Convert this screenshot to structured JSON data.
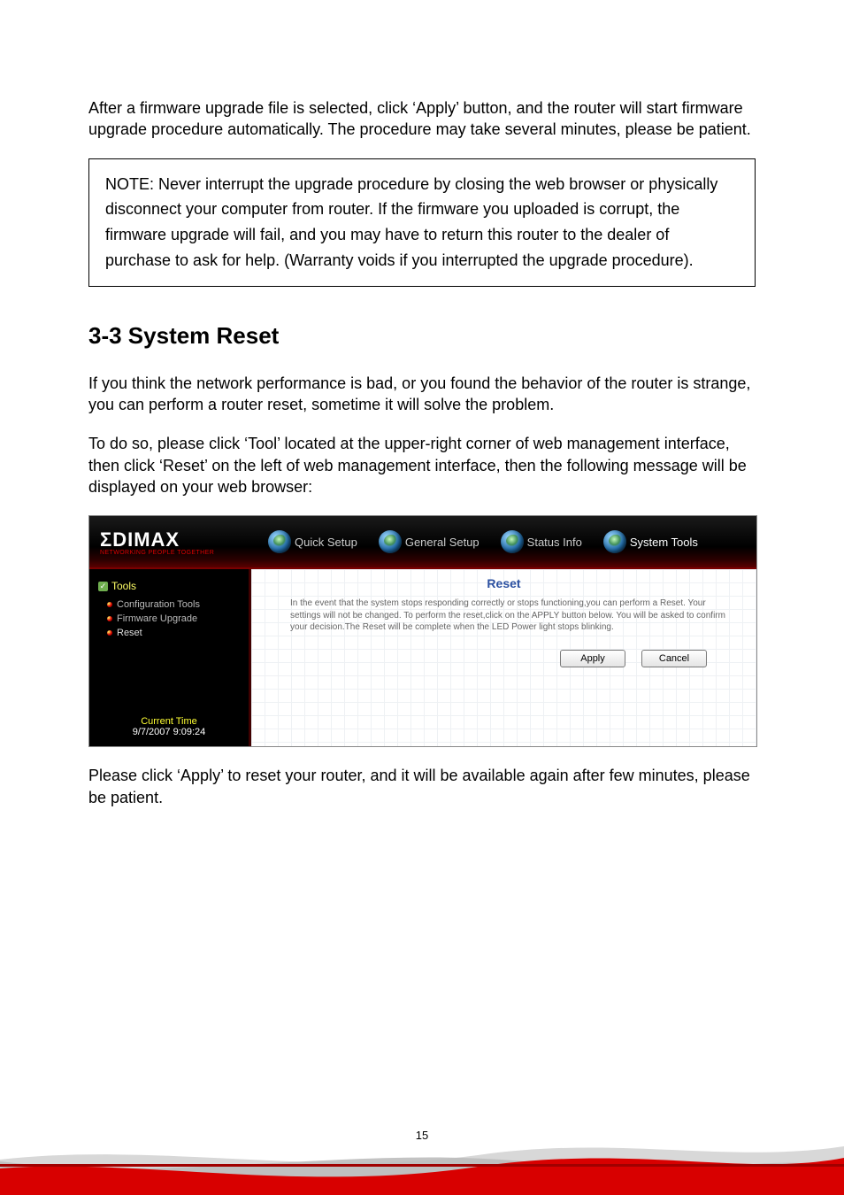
{
  "page_number": "15",
  "intro_paragraph": "After a firmware upgrade file is selected, click ‘Apply’ button, and the router will start firmware upgrade procedure automatically. The procedure may take several minutes, please be patient.",
  "note_box": "NOTE: Never interrupt the upgrade procedure by closing the web browser or physically disconnect your computer from router. If the firmware you uploaded is corrupt, the firmware upgrade will fail, and you may have to return this router to the dealer of purchase to ask for help. (Warranty voids if you interrupted the upgrade procedure).",
  "section_heading": "3-3 System Reset",
  "para2": "If you think the network performance is bad, or you found the behavior of the router is strange, you can perform a router reset, sometime it will solve the problem.",
  "para3": "To do so, please click ‘Tool’ located at the upper-right corner of web management interface, then click ‘Reset’ on the left of web management interface, then the following message will be displayed on your web browser:",
  "closing_para": "Please click ‘Apply’ to reset your router, and it will be available again after few minutes, please be patient.",
  "router_ui": {
    "logo_text": "ΣDIMAX",
    "logo_sub": "NETWORKING PEOPLE TOGETHER",
    "tabs": {
      "quick": "Quick Setup",
      "general": "General Setup",
      "status": "Status Info",
      "system": "System Tools"
    },
    "sidebar": {
      "heading": "Tools",
      "items": {
        "config": "Configuration Tools",
        "firmware": "Firmware Upgrade",
        "reset": "Reset"
      },
      "current_time_label": "Current Time",
      "current_time_value": "9/7/2007 9:09:24"
    },
    "content": {
      "title": "Reset",
      "description": "In the event that the system stops responding correctly or stops functioning,you can perform a Reset. Your settings will not be changed. To perform the reset,click on the APPLY button below. You will be asked to confirm your decision.The Reset will be complete when the LED Power light stops blinking.",
      "apply": "Apply",
      "cancel": "Cancel"
    }
  }
}
